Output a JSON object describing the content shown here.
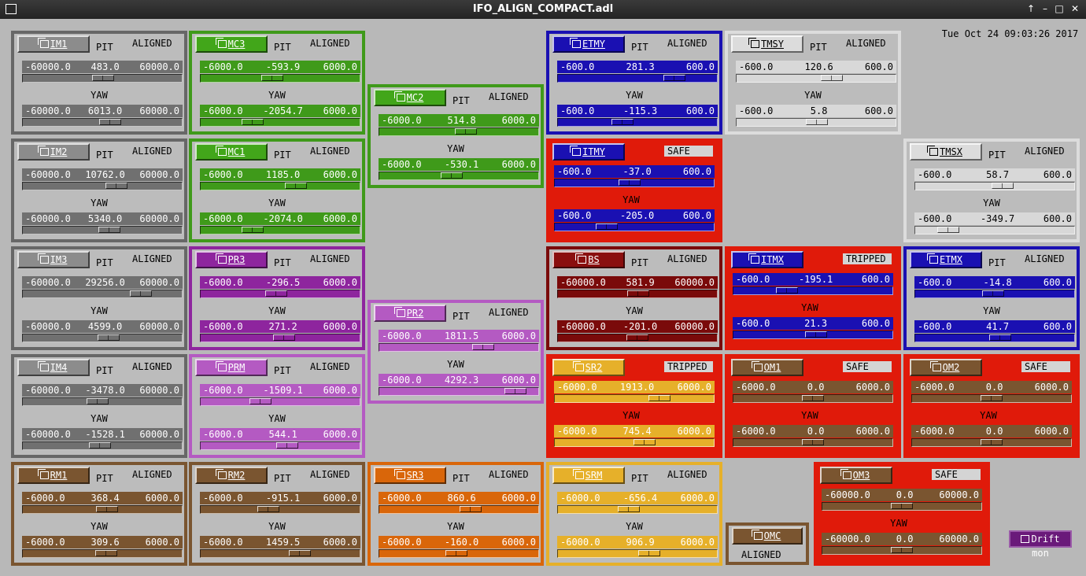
{
  "window": {
    "title": "IFO_ALIGN_COMPACT.adl",
    "controls": [
      "↑",
      "–",
      "□",
      "✕"
    ]
  },
  "clock": "Tue Oct 24 09:03:26 2017",
  "labels": {
    "pit": "PIT",
    "yaw": "YAW"
  },
  "schemes": {
    "gray": {
      "border": "#676767",
      "bg": "#bcbcbc",
      "fill": "#707070",
      "text": "#ffffff",
      "label_bg": "#8c8c8c",
      "label_fg": "#ffffff",
      "status_bg": "#bcbcbc"
    },
    "green": {
      "border": "#3f9a1a",
      "bg": "#bcbcbc",
      "fill": "#3f9a1a",
      "text": "#ffffff",
      "label_bg": "#42a61a",
      "label_fg": "#ffffff",
      "status_bg": "#bcbcbc"
    },
    "purple": {
      "border": "#8e259e",
      "bg": "#bcbcbc",
      "fill": "#8e259e",
      "text": "#ffffff",
      "label_bg": "#8e259e",
      "label_fg": "#ffffff",
      "status_bg": "#bcbcbc"
    },
    "lilac": {
      "border": "#b45ac2",
      "bg": "#bcbcbc",
      "fill": "#b45ac2",
      "text": "#ffffff",
      "label_bg": "#b45ac2",
      "label_fg": "#ffffff",
      "status_bg": "#bcbcbc"
    },
    "brown": {
      "border": "#7a5530",
      "bg": "#bcbcbc",
      "fill": "#7a5530",
      "text": "#ffffff",
      "label_bg": "#7a5530",
      "label_fg": "#ffffff",
      "status_bg": "#bcbcbc"
    },
    "orange": {
      "border": "#d9660a",
      "bg": "#bcbcbc",
      "fill": "#d9660a",
      "text": "#ffffff",
      "label_bg": "#d9660a",
      "label_fg": "#ffffff",
      "status_bg": "#bcbcbc"
    },
    "yellow": {
      "border": "#e6b02a",
      "bg": "#bcbcbc",
      "fill": "#e6b02a",
      "text": "#ffffff",
      "label_bg": "#e6b02a",
      "label_fg": "#ffffff",
      "status_bg": "#bcbcbc"
    },
    "blue": {
      "border": "#1a10b2",
      "bg": "#bcbcbc",
      "fill": "#1a10b2",
      "text": "#ffffff",
      "label_bg": "#1a10b2",
      "label_fg": "#ffffff",
      "status_bg": "#bcbcbc"
    },
    "white": {
      "border": "#dcdcdc",
      "bg": "#bcbcbc",
      "fill": "#d8d8d8",
      "text": "#000000",
      "label_bg": "#dcdcdc",
      "label_fg": "#000000",
      "status_bg": "#bcbcbc"
    },
    "darkred": {
      "border": "#7a0a0a",
      "bg": "#bcbcbc",
      "fill": "#7a0a0a",
      "text": "#ffffff",
      "label_bg": "#8a0f0f",
      "label_fg": "#ffffff",
      "status_bg": "#bcbcbc"
    },
    "red_bg": {
      "bg": "#e01a0a"
    }
  },
  "panels": [
    {
      "id": "im1",
      "name": "IM1",
      "scheme": "gray",
      "status": "ALIGNED",
      "pit": {
        "min": "-60000.0",
        "val": "483.0",
        "max": "60000.0",
        "frac": 0.504
      },
      "yaw": {
        "min": "-60000.0",
        "val": "6013.0",
        "max": "60000.0",
        "frac": 0.55
      }
    },
    {
      "id": "im2",
      "name": "IM2",
      "scheme": "gray",
      "status": "ALIGNED",
      "pit": {
        "min": "-60000.0",
        "val": "10762.0",
        "max": "60000.0",
        "frac": 0.59
      },
      "yaw": {
        "min": "-60000.0",
        "val": "5340.0",
        "max": "60000.0",
        "frac": 0.545
      }
    },
    {
      "id": "im3",
      "name": "IM3",
      "scheme": "gray",
      "status": "ALIGNED",
      "pit": {
        "min": "-60000.0",
        "val": "29256.0",
        "max": "60000.0",
        "frac": 0.744
      },
      "yaw": {
        "min": "-60000.0",
        "val": "4599.0",
        "max": "60000.0",
        "frac": 0.538
      }
    },
    {
      "id": "im4",
      "name": "IM4",
      "scheme": "gray",
      "status": "ALIGNED",
      "pit": {
        "min": "-60000.0",
        "val": "-3478.0",
        "max": "60000.0",
        "frac": 0.471
      },
      "yaw": {
        "min": "-60000.0",
        "val": "-1528.1",
        "max": "60000.0",
        "frac": 0.487
      }
    },
    {
      "id": "rm1",
      "name": "RM1",
      "scheme": "brown",
      "status": "ALIGNED",
      "pit": {
        "min": "-6000.0",
        "val": "368.4",
        "max": "6000.0",
        "frac": 0.531
      },
      "yaw": {
        "min": "-6000.0",
        "val": "309.6",
        "max": "6000.0",
        "frac": 0.526
      }
    },
    {
      "id": "mc3",
      "name": "MC3",
      "scheme": "green",
      "status": "ALIGNED",
      "pit": {
        "min": "-6000.0",
        "val": "-593.9",
        "max": "6000.0",
        "frac": 0.451
      },
      "yaw": {
        "min": "-6000.0",
        "val": "-2054.7",
        "max": "6000.0",
        "frac": 0.329
      }
    },
    {
      "id": "mc1",
      "name": "MC1",
      "scheme": "green",
      "status": "ALIGNED",
      "pit": {
        "min": "-6000.0",
        "val": "1185.0",
        "max": "6000.0",
        "frac": 0.599
      },
      "yaw": {
        "min": "-6000.0",
        "val": "-2074.0",
        "max": "6000.0",
        "frac": 0.327
      }
    },
    {
      "id": "pr3",
      "name": "PR3",
      "scheme": "purple",
      "status": "ALIGNED",
      "pit": {
        "min": "-6000.0",
        "val": "-296.5",
        "max": "6000.0",
        "frac": 0.475
      },
      "yaw": {
        "min": "-6000.0",
        "val": "271.2",
        "max": "6000.0",
        "frac": 0.523
      }
    },
    {
      "id": "prm",
      "name": "PRM",
      "scheme": "lilac",
      "status": "ALIGNED",
      "pit": {
        "min": "-6000.0",
        "val": "-1509.1",
        "max": "6000.0",
        "frac": 0.374
      },
      "yaw": {
        "min": "-6000.0",
        "val": "544.1",
        "max": "6000.0",
        "frac": 0.545
      }
    },
    {
      "id": "rm2",
      "name": "RM2",
      "scheme": "brown",
      "status": "ALIGNED",
      "pit": {
        "min": "-6000.0",
        "val": "-915.1",
        "max": "6000.0",
        "frac": 0.424
      },
      "yaw": {
        "min": "-6000.0",
        "val": "1459.5",
        "max": "6000.0",
        "frac": 0.622
      }
    },
    {
      "id": "mc2",
      "name": "MC2",
      "scheme": "green",
      "status": "ALIGNED",
      "pit": {
        "min": "-6000.0",
        "val": "514.8",
        "max": "6000.0",
        "frac": 0.543
      },
      "yaw": {
        "min": "-6000.0",
        "val": "-530.1",
        "max": "6000.0",
        "frac": 0.456
      }
    },
    {
      "id": "pr2",
      "name": "PR2",
      "scheme": "lilac",
      "status": "ALIGNED",
      "pit": {
        "min": "-6000.0",
        "val": "1811.5",
        "max": "6000.0",
        "frac": 0.651
      },
      "yaw": {
        "min": "-6000.0",
        "val": "4292.3",
        "max": "6000.0",
        "frac": 0.858
      }
    },
    {
      "id": "sr3",
      "name": "SR3",
      "scheme": "orange",
      "status": "ALIGNED",
      "pit": {
        "min": "-6000.0",
        "val": "860.6",
        "max": "6000.0",
        "frac": 0.572
      },
      "yaw": {
        "min": "-6000.0",
        "val": "-160.0",
        "max": "6000.0",
        "frac": 0.487
      }
    },
    {
      "id": "etmy",
      "name": "ETMY",
      "scheme": "blue",
      "status": "ALIGNED",
      "pit": {
        "min": "-600.0",
        "val": "281.3",
        "max": "600.0",
        "frac": 0.734
      },
      "yaw": {
        "min": "-600.0",
        "val": "-115.3",
        "max": "600.0",
        "frac": 0.404
      }
    },
    {
      "id": "itmy",
      "name": "ITMY",
      "scheme": "blue",
      "status": "SAFE",
      "red": true,
      "pit": {
        "min": "-600.0",
        "val": "-37.0",
        "max": "600.0",
        "frac": 0.469
      },
      "yaw": {
        "min": "-600.0",
        "val": "-205.0",
        "max": "600.0",
        "frac": 0.329
      }
    },
    {
      "id": "bs",
      "name": "BS",
      "scheme": "darkred",
      "status": "ALIGNED",
      "pit": {
        "min": "-60000.0",
        "val": "581.9",
        "max": "60000.0",
        "frac": 0.505
      },
      "yaw": {
        "min": "-60000.0",
        "val": "-201.0",
        "max": "60000.0",
        "frac": 0.498
      }
    },
    {
      "id": "sr2",
      "name": "SR2",
      "scheme": "yellow",
      "status": "TRIPPED",
      "red": true,
      "pit": {
        "min": "-6000.0",
        "val": "1913.0",
        "max": "6000.0",
        "frac": 0.659
      },
      "yaw": {
        "min": "-6000.0",
        "val": "745.4",
        "max": "6000.0",
        "frac": 0.562
      }
    },
    {
      "id": "srm",
      "name": "SRM",
      "scheme": "yellow",
      "status": "ALIGNED",
      "pit": {
        "min": "-6000.0",
        "val": "-656.4",
        "max": "6000.0",
        "frac": 0.445
      },
      "yaw": {
        "min": "-6000.0",
        "val": "906.9",
        "max": "6000.0",
        "frac": 0.576
      }
    },
    {
      "id": "tmsy",
      "name": "TMSY",
      "scheme": "white",
      "status": "ALIGNED",
      "pit": {
        "min": "-600.0",
        "val": "120.6",
        "max": "600.0",
        "frac": 0.601
      },
      "yaw": {
        "min": "-600.0",
        "val": "5.8",
        "max": "600.0",
        "frac": 0.505
      }
    },
    {
      "id": "itmx",
      "name": "ITMX",
      "scheme": "blue",
      "status": "TRIPPED",
      "red": true,
      "pit": {
        "min": "-600.0",
        "val": "-195.1",
        "max": "600.0",
        "frac": 0.337
      },
      "yaw": {
        "min": "-600.0",
        "val": "21.3",
        "max": "600.0",
        "frac": 0.518
      }
    },
    {
      "id": "om1",
      "name": "OM1",
      "scheme": "brown",
      "status": "SAFE",
      "red": true,
      "pit": {
        "min": "-6000.0",
        "val": "0.0",
        "max": "6000.0",
        "frac": 0.5
      },
      "yaw": {
        "min": "-6000.0",
        "val": "0.0",
        "max": "6000.0",
        "frac": 0.5
      }
    },
    {
      "id": "om3",
      "name": "OM3",
      "scheme": "brown",
      "status": "SAFE",
      "red": true,
      "pit": {
        "min": "-60000.0",
        "val": "0.0",
        "max": "60000.0",
        "frac": 0.5
      },
      "yaw": {
        "min": "-60000.0",
        "val": "0.0",
        "max": "60000.0",
        "frac": 0.5
      }
    },
    {
      "id": "tmsx",
      "name": "TMSX",
      "scheme": "white",
      "status": "ALIGNED",
      "pit": {
        "min": "-600.0",
        "val": "58.7",
        "max": "600.0",
        "frac": 0.549
      },
      "yaw": {
        "min": "-600.0",
        "val": "-349.7",
        "max": "600.0",
        "frac": 0.209
      }
    },
    {
      "id": "etmx",
      "name": "ETMX",
      "scheme": "blue",
      "status": "ALIGNED",
      "pit": {
        "min": "-600.0",
        "val": "-14.8",
        "max": "600.0",
        "frac": 0.488
      },
      "yaw": {
        "min": "-600.0",
        "val": "41.7",
        "max": "600.0",
        "frac": 0.535
      }
    },
    {
      "id": "om2",
      "name": "OM2",
      "scheme": "brown",
      "status": "SAFE",
      "red": true,
      "pit": {
        "min": "-6000.0",
        "val": "0.0",
        "max": "6000.0",
        "frac": 0.5
      },
      "yaw": {
        "min": "-6000.0",
        "val": "0.0",
        "max": "6000.0",
        "frac": 0.5
      }
    }
  ],
  "omc": {
    "name": "OMC",
    "status": "ALIGNED"
  },
  "drift_button": "Drift mon"
}
